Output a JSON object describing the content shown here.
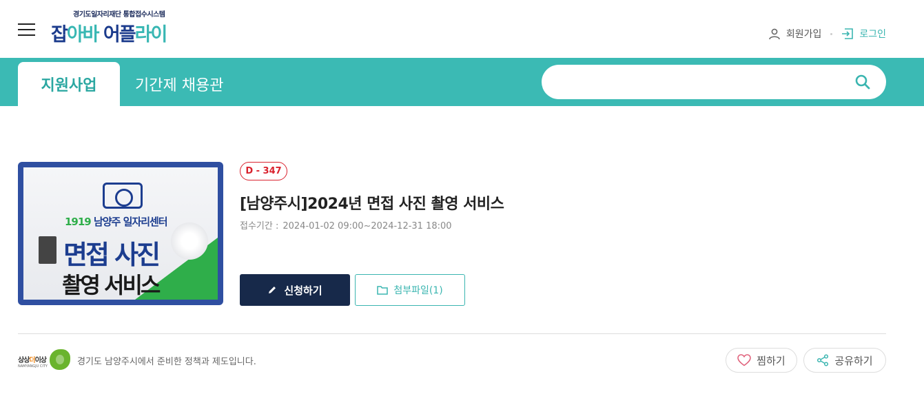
{
  "header": {
    "logo_sub": "경기도일자리재단 통합접수시스템",
    "logo_part1": "잡",
    "logo_part2": "아바",
    "logo_part3": " 어플",
    "logo_part4": "라이",
    "join_label": "회원가입",
    "login_label": "로그인"
  },
  "nav": {
    "tabs": [
      {
        "label": "지원사업",
        "active": true
      },
      {
        "label": "기간제 채용관",
        "active": false
      }
    ],
    "search": {
      "value": "",
      "placeholder": ""
    }
  },
  "program": {
    "thumbnail": {
      "line1_prefix": "1919",
      "line1_rest": " 남양주 일자리센터",
      "line2": "면접 사진",
      "line3": "촬영 서비스"
    },
    "dday": "D - 347",
    "title": "[남양주시]2024년 면접 사진 촬영 서비스",
    "period_label": "접수기간 :",
    "period_value": "2024-01-02 09:00~2024-12-31 18:00",
    "apply_label": "신청하기",
    "attachment_label": "첨부파일(1)"
  },
  "footer": {
    "org_logo_text1": "상상",
    "org_logo_text2": "더",
    "org_logo_text3": "이상",
    "org_logo_sub": "NAMYANGJU CITY",
    "description": "경기도 남양주시에서 준비한 정책과 제도입니다.",
    "like_label": "찜하기",
    "share_label": "공유하기"
  },
  "colors": {
    "brand_teal": "#3bbab4",
    "navy_button": "#17294a",
    "dday_red": "#d9222e"
  }
}
